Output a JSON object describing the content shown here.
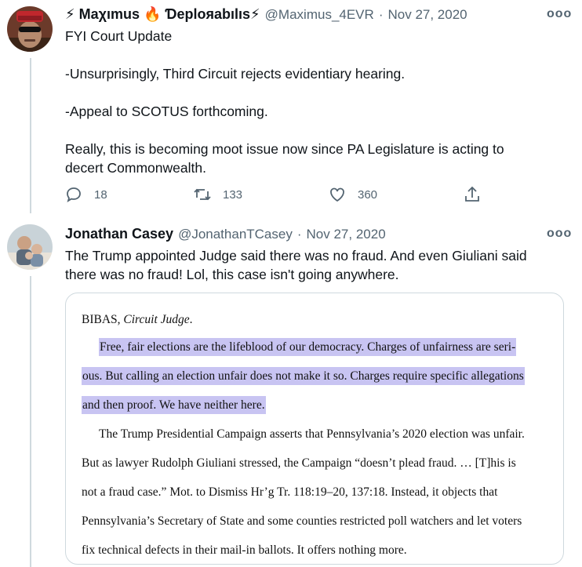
{
  "tweet1": {
    "display_name": "⚡ Maχımus 🔥 Ɗeploяabılıs⚡",
    "handle": "@Maximus_4EVR",
    "separator": "·",
    "date": "Nov 27, 2020",
    "more": "ooo",
    "text": "FYI Court Update\n\n-Unsurprisingly, Third Circuit rejects evidentiary hearing.\n\n-Appeal to SCOTUS forthcoming.\n\nReally, this is becoming moot issue now since PA Legislature is acting to\ndecert Commonwealth.",
    "replies": "18",
    "retweets": "133",
    "likes": "360",
    "icons": [
      "reply-icon",
      "retweet-icon",
      "like-icon",
      "share-icon"
    ]
  },
  "tweet2": {
    "display_name": "Jonathan Casey",
    "handle": "@JonathanTCasey",
    "separator": "·",
    "date": "Nov 27, 2020",
    "more": "ooo",
    "text": "The Trump appointed Judge said there was no fraud. And even Giuliani said\nthere was no fraud! Lol, this case isn't going anywhere.",
    "document": {
      "heading_name": "BIBAS, ",
      "heading_title": "Circuit Judge",
      "heading_end": ".",
      "highlighted_lines": [
        "Free, fair elections are the lifeblood of our democracy. Charges of unfairness are seri-",
        "ous. But calling an election unfair does not make it so. Charges require specific allegations",
        "and then proof. We have neither here."
      ],
      "body_lines": [
        "The Trump Presidential Campaign asserts that Pennsylvania’s 2020 election was unfair.",
        "But as lawyer Rudolph Giuliani stressed, the Campaign “doesn’t plead fraud. … [T]his is",
        "not a fraud case.” Mot. to Dismiss Hr’g Tr. 118:19–20, 137:18. Instead, it objects that",
        "Pennsylvania’s Secretary of State and some counties restricted poll watchers and let voters",
        "fix technical defects in their mail-in ballots. It offers nothing more."
      ]
    }
  },
  "colors": {
    "text": "#0f1419",
    "secondary": "#536471",
    "highlight": "#c8c4f2",
    "border": "#cfd9de"
  }
}
